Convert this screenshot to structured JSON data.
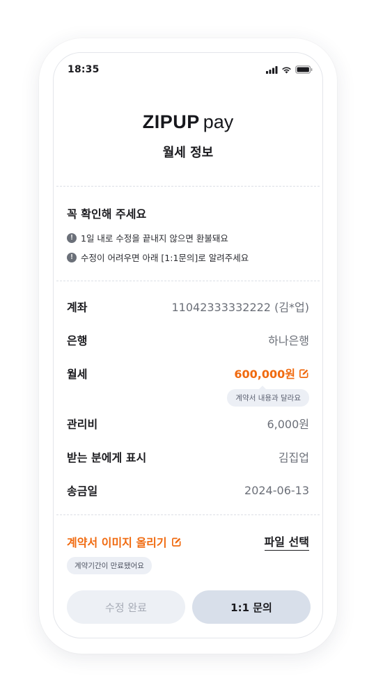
{
  "status_bar": {
    "time": "18:35"
  },
  "logo": {
    "brand": "ZIPUP",
    "suffix": "pay"
  },
  "page_title": "월세 정보",
  "notice": {
    "title": "꼭 확인해 주세요",
    "items": [
      "1일 내로 수정을 끝내지 않으면 환불돼요",
      "수정이 어려우면 아래 [1:1문의]로 알려주세요"
    ]
  },
  "details": [
    {
      "label": "계좌",
      "value": "11042333332222 (김*업)"
    },
    {
      "label": "은행",
      "value": "하나은행"
    },
    {
      "label": "월세",
      "value": "600,000원"
    },
    {
      "label": "관리비",
      "value": "6,000원"
    },
    {
      "label": "받는 분에게 표시",
      "value": "김집업"
    },
    {
      "label": "송금일",
      "value": "2024-06-13"
    }
  ],
  "rent_tooltip": "계약서 내용과 달라요",
  "upload": {
    "label": "계약서 이미지 올리기",
    "file_select": "파일 선택",
    "badge": "계약기간이 만료됐어요"
  },
  "buttons": {
    "done": "수정 완료",
    "inquiry": "1:1 문의"
  },
  "colors": {
    "accent": "#f06a0f",
    "text": "#1b1b1f",
    "muted": "#6b6f78",
    "pill_bg": "#eceff5",
    "primary_button": "#d8dfea",
    "disabled_button": "#edf0f5"
  },
  "icons": {
    "signal": "cellular-signal-icon",
    "wifi": "wifi-icon",
    "battery": "battery-icon",
    "warning": "exclamation-circle-icon",
    "edit": "edit-pencil-icon"
  }
}
